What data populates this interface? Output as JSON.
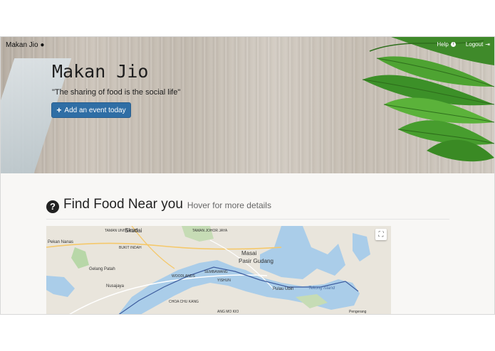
{
  "navbar": {
    "brand": "Makan Jio",
    "brand_icon": "spoon-icon",
    "help": "Help",
    "help_icon": "info-icon",
    "logout": "Logout",
    "logout_icon": "logout-icon"
  },
  "hero": {
    "title": "Makan Jio",
    "quote": "\"The sharing of food is the social life\"",
    "button_label": "Add an event today",
    "button_icon": "plus-icon",
    "button_color": "#2f6ea5"
  },
  "section": {
    "icon": "question-circle-icon",
    "title": "Find Food Near you",
    "subtitle": "Hover for more details"
  },
  "map": {
    "water_color": "#a8cbe8",
    "land_color": "#e8e4dc",
    "labels": {
      "taman_universiti": "TAMAN UNIVERSITI",
      "skudai": "Skudai",
      "taman_johor_jaya": "TAMAN JOHOR JAYA",
      "pekan_nanas": "Pekan Nanas",
      "bukit_indah": "BUKIT INDAH",
      "masai": "Masai",
      "pasir_gudang": "Pasir Gudang",
      "gelang_patah": "Gelang Patah",
      "nusajaya": "Nusajaya",
      "woodlands": "WOODLANDS",
      "pulau_ubin": "Pulau Ubin",
      "tekong_island": "Tekong Island",
      "sembawang": "SEMBAWANG",
      "yishun": "YISHUN",
      "pengerang": "Pengerang",
      "ang_mo_kio": "ANG MO KIO",
      "choa_chu_kang": "CHOA CHU KANG"
    },
    "fullscreen_icon": "fullscreen-icon"
  }
}
